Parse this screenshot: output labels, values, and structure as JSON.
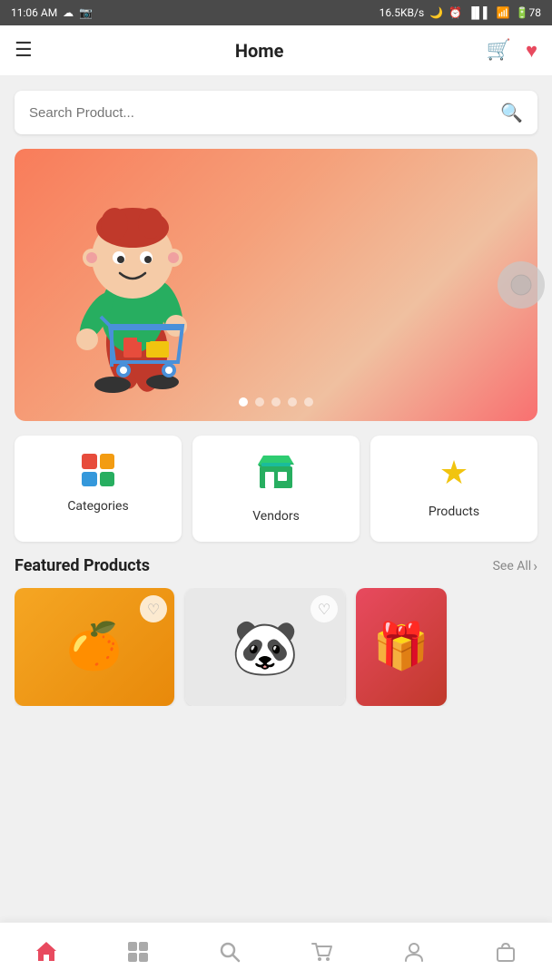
{
  "statusBar": {
    "time": "11:06 AM",
    "network": "16.5KB/s",
    "battery": "78"
  },
  "header": {
    "menuIcon": "☰",
    "title": "Home",
    "cartIcon": "🛒",
    "heartIcon": "♥"
  },
  "search": {
    "placeholder": "Search Product...",
    "icon": "🔍"
  },
  "banner": {
    "dots": [
      true,
      false,
      false,
      false,
      false
    ]
  },
  "categories": [
    {
      "id": "categories",
      "label": "Categories",
      "iconType": "grid"
    },
    {
      "id": "vendors",
      "label": "Vendors",
      "iconType": "store"
    },
    {
      "id": "products",
      "label": "Products",
      "iconType": "star"
    }
  ],
  "featuredSection": {
    "title": "Featured Products",
    "seeAll": "See All"
  },
  "products": [
    {
      "id": 1,
      "emoji": "🍊",
      "type": "orange"
    },
    {
      "id": 2,
      "emoji": "🐼",
      "type": "panda"
    },
    {
      "id": 3,
      "emoji": "🎁",
      "type": "red"
    }
  ],
  "bottomNav": [
    {
      "id": "home",
      "icon": "⌂",
      "active": true
    },
    {
      "id": "grid",
      "icon": "⊞",
      "active": false
    },
    {
      "id": "search",
      "icon": "⌕",
      "active": false
    },
    {
      "id": "cart",
      "icon": "🛒",
      "active": false
    },
    {
      "id": "profile",
      "icon": "👤",
      "active": false
    },
    {
      "id": "bag",
      "icon": "🛍",
      "active": false
    }
  ]
}
